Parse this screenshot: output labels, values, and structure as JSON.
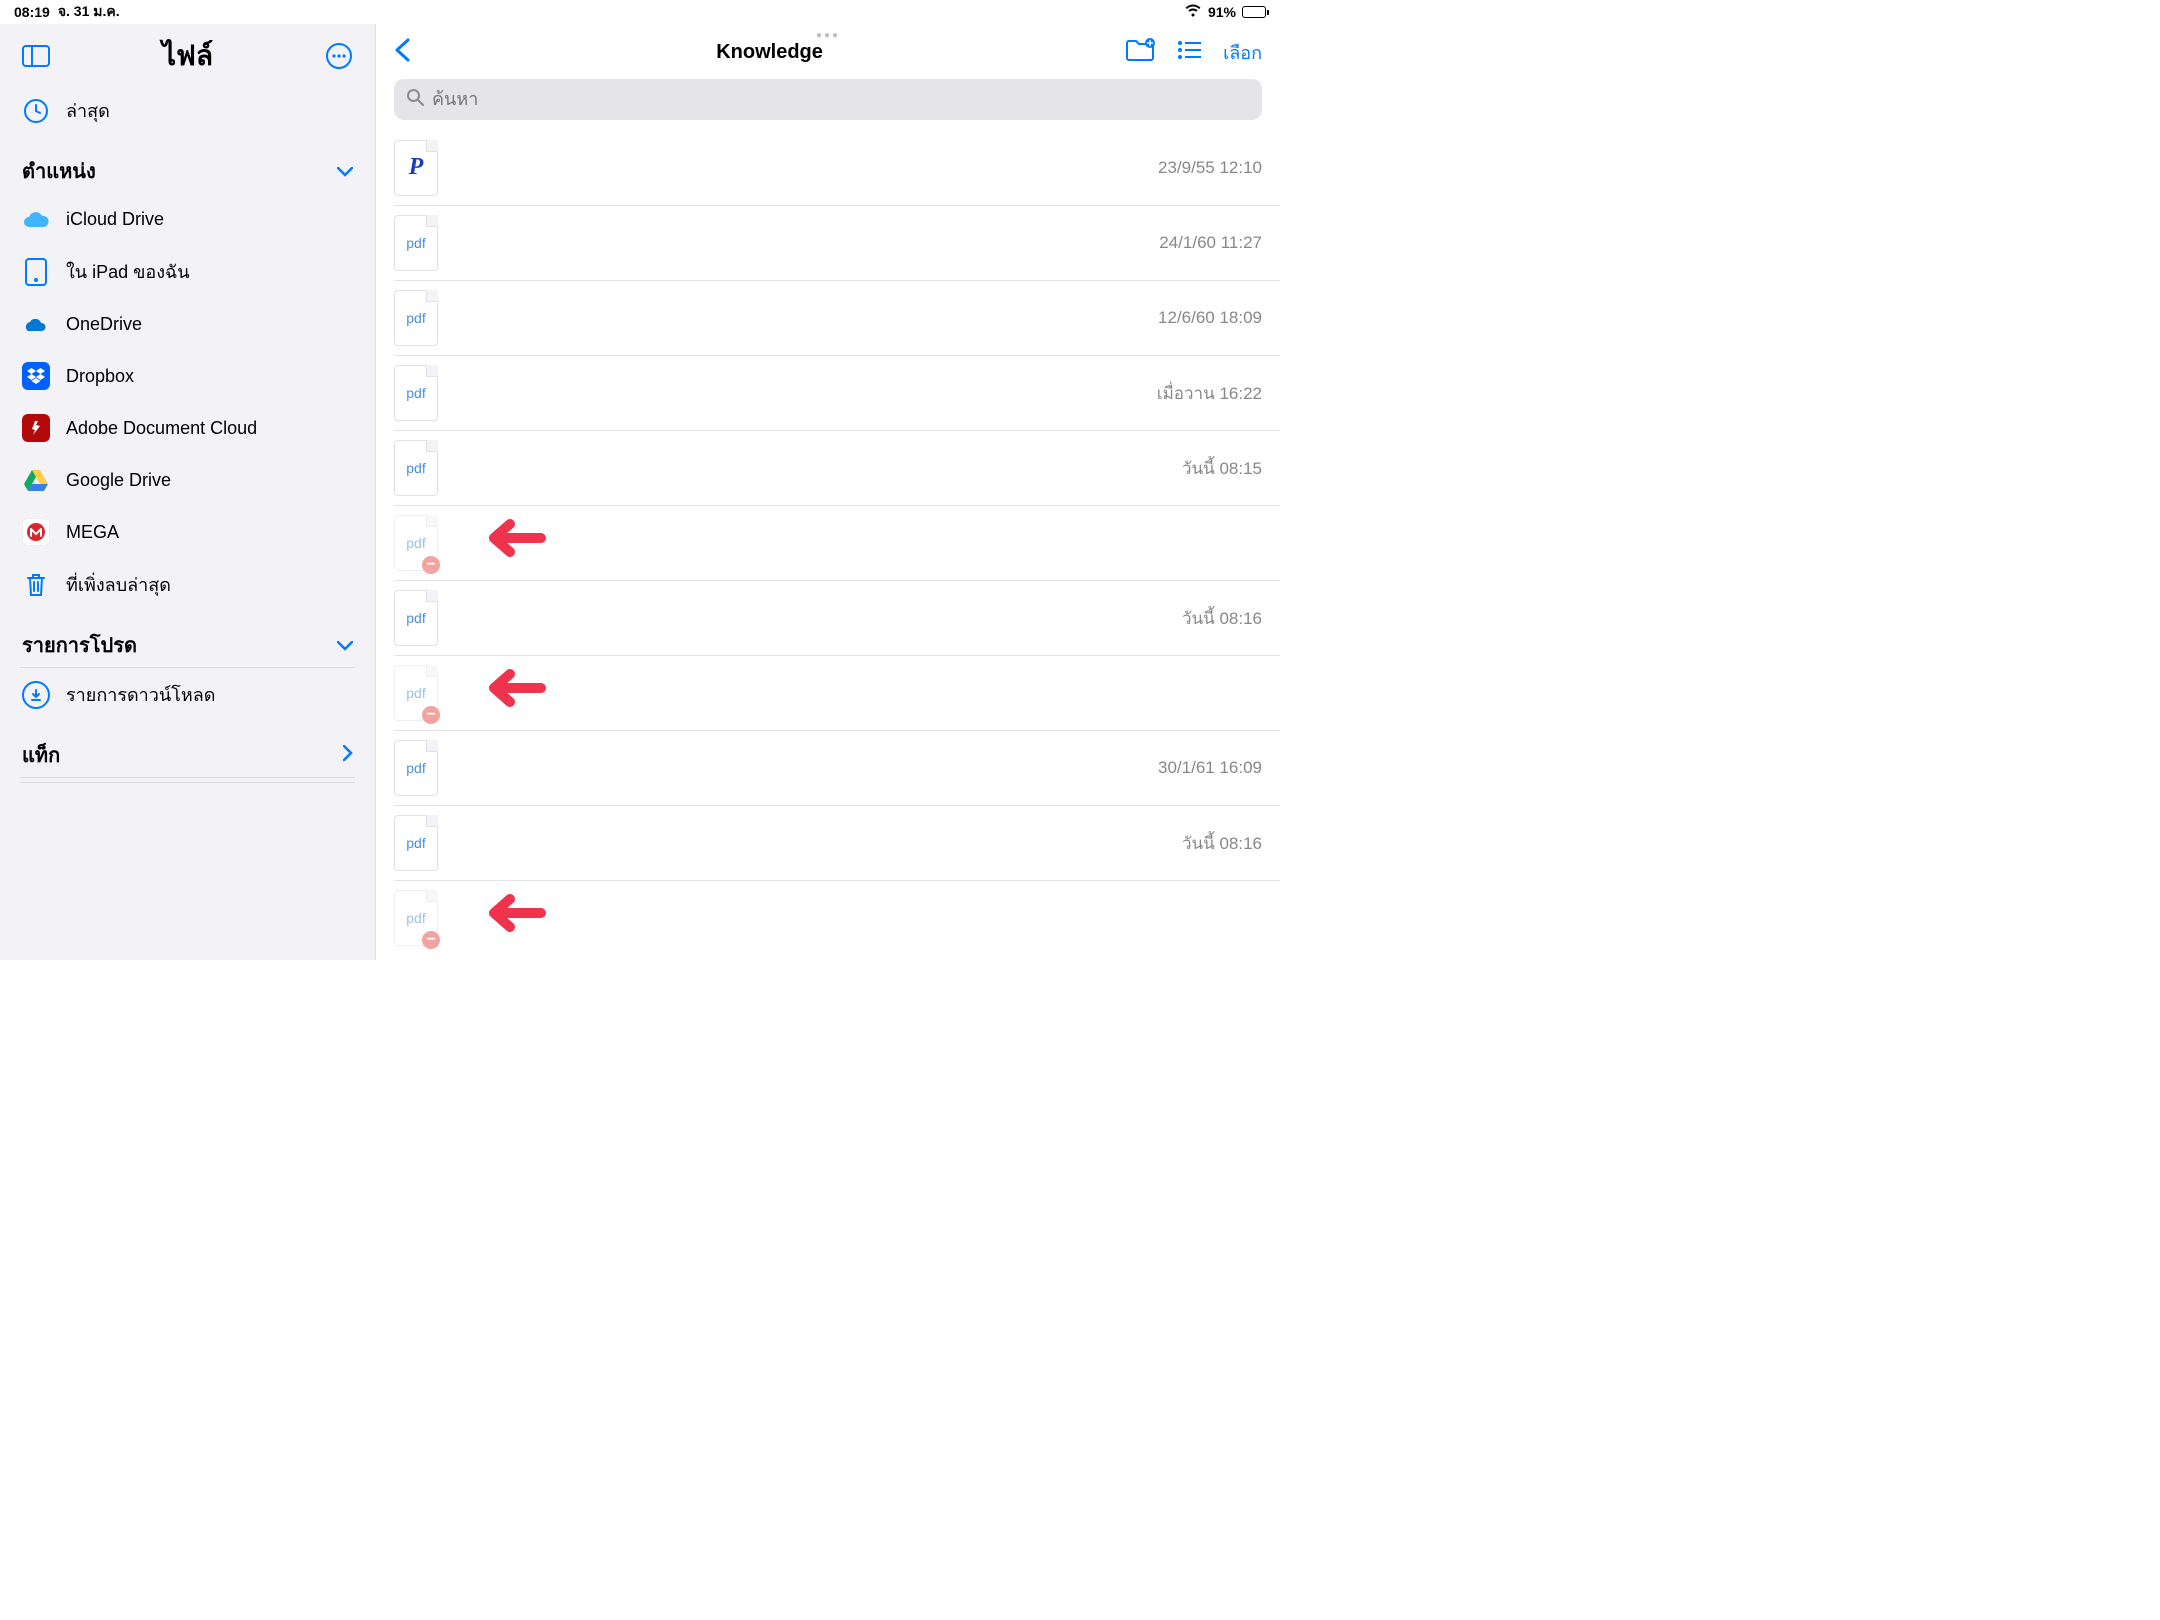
{
  "status": {
    "time": "08:19",
    "date": "จ. 31 ม.ค.",
    "battery_pct": "91%"
  },
  "sidebar": {
    "title": "ไฟล์",
    "recent": "ล่าสุด",
    "locations_header": "ตำแหน่ง",
    "locations": [
      {
        "label": "iCloud Drive"
      },
      {
        "label": "ใน iPad ของฉัน"
      },
      {
        "label": "OneDrive"
      },
      {
        "label": "Dropbox"
      },
      {
        "label": "Adobe Document Cloud"
      },
      {
        "label": "Google Drive"
      },
      {
        "label": "MEGA"
      },
      {
        "label": "ที่เพิ่งลบล่าสุด"
      }
    ],
    "favorites_header": "รายการโปรด",
    "downloads": "รายการดาวน์โหลด",
    "tags_header": "แท็ก"
  },
  "main": {
    "title": "Knowledge",
    "select": "เลือก",
    "search_placeholder": "ค้นหา"
  },
  "files": [
    {
      "type": "p",
      "date": "23/9/55 12:10",
      "faded": false,
      "minus": false,
      "arrow": false
    },
    {
      "type": "pdf",
      "date": "24/1/60 11:27",
      "faded": false,
      "minus": false,
      "arrow": false
    },
    {
      "type": "pdf",
      "date": "12/6/60 18:09",
      "faded": false,
      "minus": false,
      "arrow": false
    },
    {
      "type": "pdf",
      "date": "เมื่อวาน 16:22",
      "faded": false,
      "minus": false,
      "arrow": false
    },
    {
      "type": "pdf",
      "date": "วันนี้ 08:15",
      "faded": false,
      "minus": false,
      "arrow": false
    },
    {
      "type": "pdf",
      "date": "",
      "faded": true,
      "minus": true,
      "arrow": true
    },
    {
      "type": "pdf",
      "date": "วันนี้ 08:16",
      "faded": false,
      "minus": false,
      "arrow": false
    },
    {
      "type": "pdf",
      "date": "",
      "faded": true,
      "minus": true,
      "arrow": true
    },
    {
      "type": "pdf",
      "date": "30/1/61 16:09",
      "faded": false,
      "minus": false,
      "arrow": false
    },
    {
      "type": "pdf",
      "date": "วันนี้ 08:16",
      "faded": false,
      "minus": false,
      "arrow": false
    },
    {
      "type": "pdf",
      "date": "",
      "faded": true,
      "minus": true,
      "arrow": true
    }
  ]
}
